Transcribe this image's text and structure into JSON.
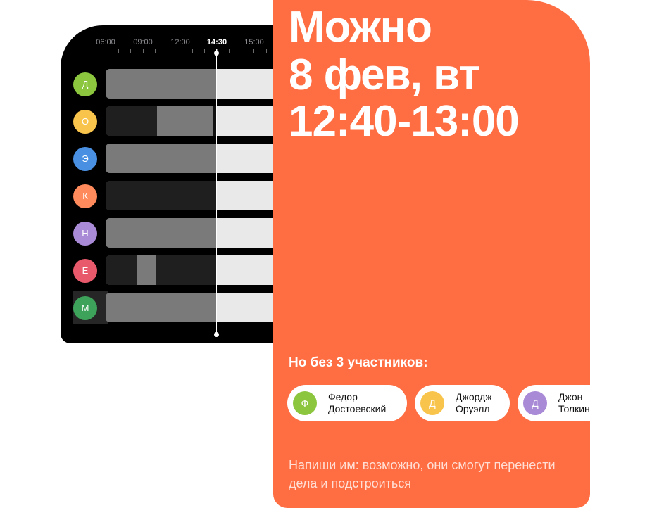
{
  "timeline": {
    "ticks": [
      "06:00",
      "09:00",
      "12:00",
      "14:30",
      "15:00"
    ],
    "current_time": "14:30"
  },
  "participants": [
    {
      "initial": "Д",
      "color": "#8cc63f",
      "busy_to_now": true
    },
    {
      "initial": "О",
      "color": "#f9c44b",
      "busy_to_now": false
    },
    {
      "initial": "Э",
      "color": "#4a90e2",
      "busy_to_now": true
    },
    {
      "initial": "К",
      "color": "#ff8a5c",
      "busy_to_now": false
    },
    {
      "initial": "Н",
      "color": "#a98ad6",
      "busy_to_now": true
    },
    {
      "initial": "Е",
      "color": "#e85a6b",
      "busy_to_now": false
    },
    {
      "initial": "М",
      "color": "#3ea35a",
      "busy_to_now": true
    }
  ],
  "card": {
    "headline_line1": "Можно",
    "headline_line2": "8 фев, вт",
    "headline_line3": "12:40-13:00",
    "subtitle": "Но без 3 участников:",
    "chips": [
      {
        "initial": "Ф",
        "color": "#8cc63f",
        "first": "Федор",
        "last": "Достоевский"
      },
      {
        "initial": "Д",
        "color": "#f9c44b",
        "first": "Джордж",
        "last": "Оруэлл"
      },
      {
        "initial": "Д",
        "color": "#a98ad6",
        "first": "Джон",
        "last": "Толкин"
      }
    ],
    "footnote": "Напиши им: возможно, они смогут перенести дела и подстроиться"
  },
  "colors": {
    "accent": "#ff6d42",
    "panel": "#000000",
    "busy": "#7a7a7a",
    "free": "#1f1f1f",
    "after_now": "#e9e9e9"
  }
}
